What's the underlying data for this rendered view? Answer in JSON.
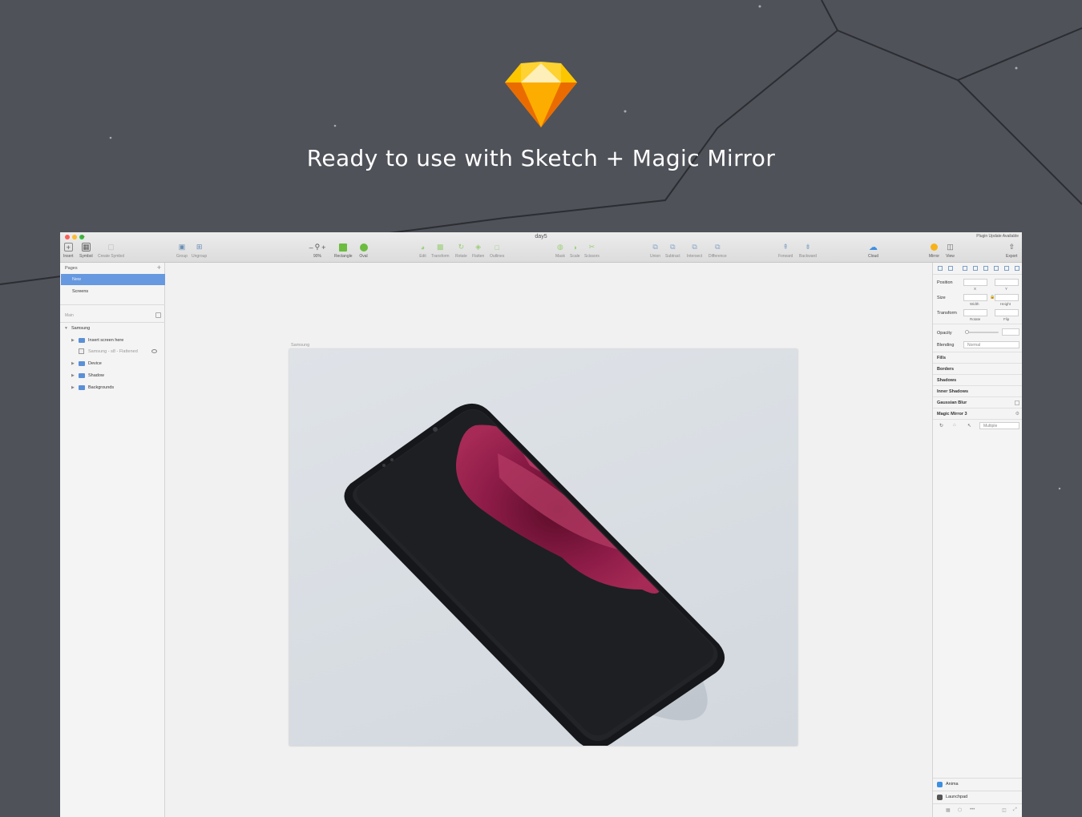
{
  "headline": "Ready to use with Sketch + Magic Mirror",
  "colors": {
    "background": "#4f5259",
    "accent": "#6699e0",
    "logo_orange": "#f7a21b",
    "rose": "#9b1f4f"
  },
  "window": {
    "title": "day5",
    "plugin_note": "Plugin Update Available"
  },
  "toolbar": {
    "insert": "Insert",
    "symbol": "Symbol",
    "create_symbol": "Create Symbol",
    "group": "Group",
    "ungroup": "Ungroup",
    "zoom_minus": "–",
    "zoom_plus": "+",
    "zoom_value": "90%",
    "rectangle": "Rectangle",
    "oval": "Oval",
    "edit": "Edit",
    "transform": "Transform",
    "rotate": "Rotate",
    "flatten": "Flatten",
    "outlines": "Outlines",
    "mask": "Mask",
    "scale": "Scale",
    "scissors": "Scissors",
    "union": "Union",
    "subtract": "Subtract",
    "intersect": "Intersect",
    "difference": "Difference",
    "forward": "Forward",
    "backward": "Backward",
    "cloud": "Cloud",
    "mirror": "Mirror",
    "view": "View",
    "export": "Export"
  },
  "left_panel": {
    "pages_title": "Pages",
    "add": "+",
    "pages": [
      "New",
      "Screens"
    ],
    "layers_title": "Main",
    "layers": {
      "root": "Samsung",
      "insert": "Insert screen here",
      "flattened": "Samsung - s8 - Flattened",
      "device": "Device",
      "shadow": "Shadow",
      "backgrounds": "Backgrounds"
    }
  },
  "canvas": {
    "artboard_label": "Samsung"
  },
  "inspector": {
    "position": "Position",
    "x": "X",
    "y": "Y",
    "size": "Size",
    "width": "Width",
    "height": "Height",
    "transform": "Transform",
    "rotate": "Rotate",
    "flip": "Flip",
    "opacity": "Opacity",
    "blending": "Blending",
    "blending_value": "Normal",
    "fills": "Fills",
    "borders": "Borders",
    "shadows": "Shadows",
    "inner_shadows": "Inner Shadows",
    "gaussian_blur": "Gaussian Blur",
    "magic_mirror": "Magic Mirror 3",
    "multiple": "Multiple",
    "plugins": [
      "Anima",
      "Launchpad"
    ]
  }
}
